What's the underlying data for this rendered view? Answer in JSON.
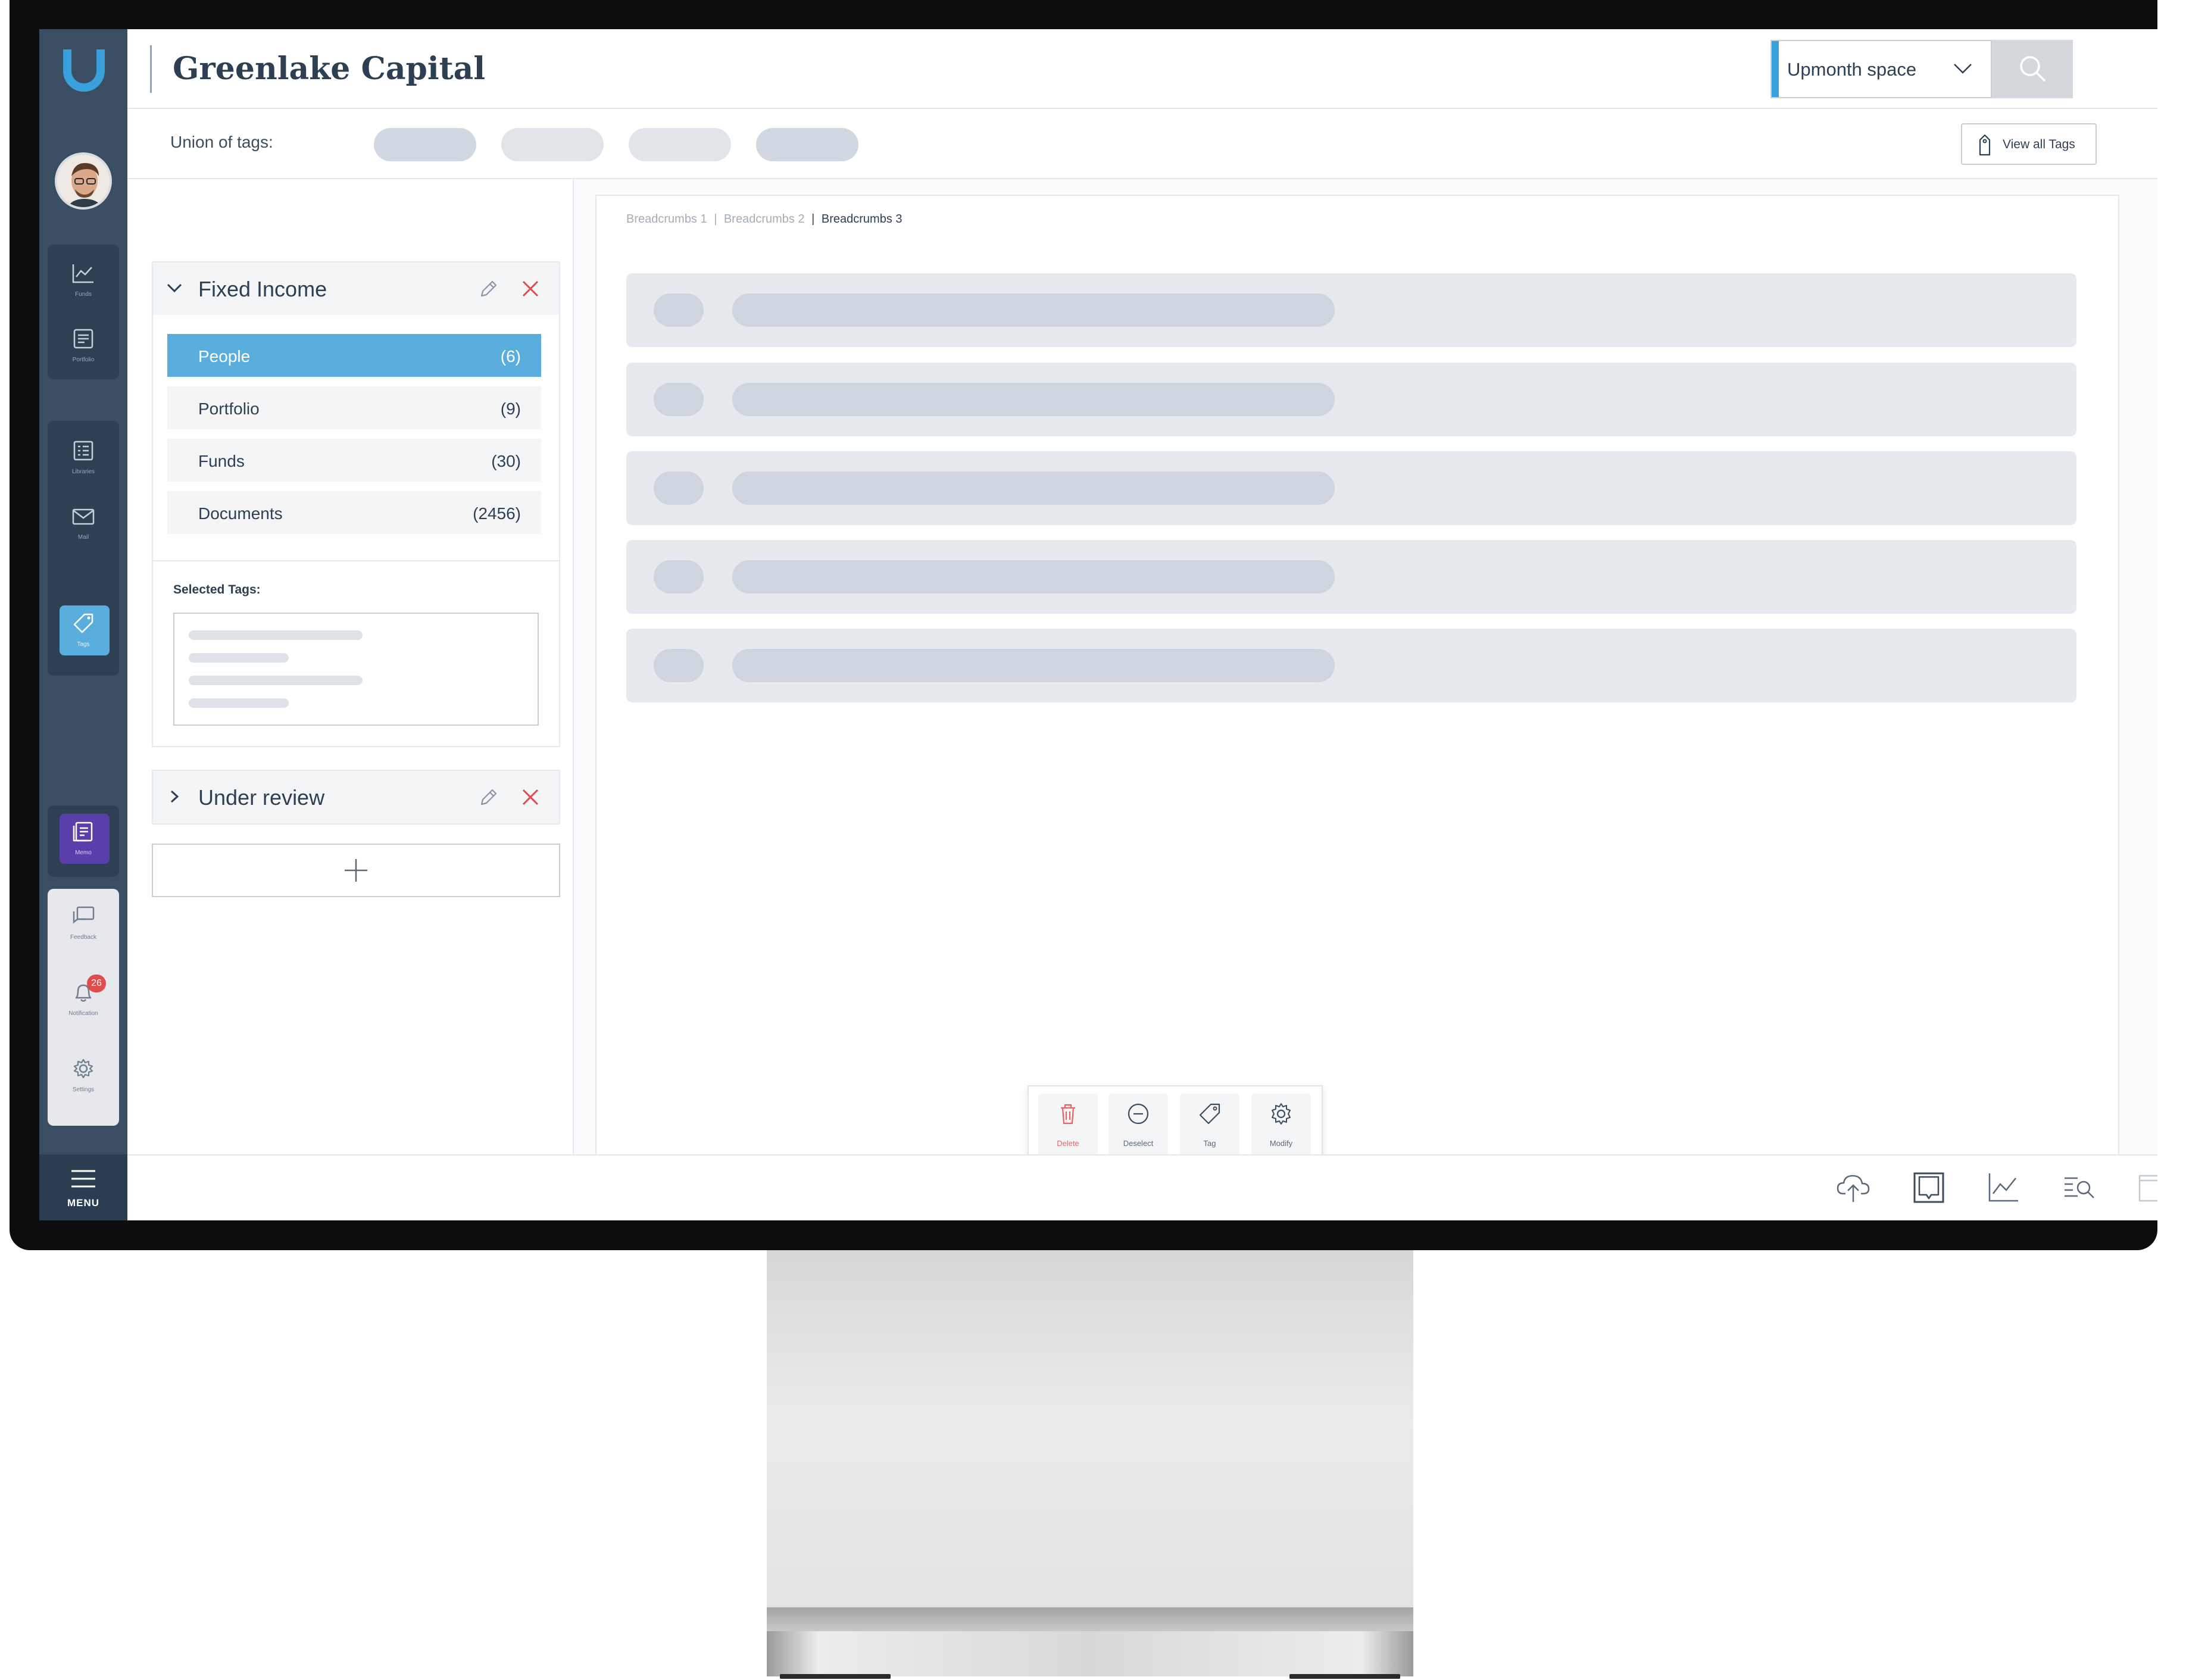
{
  "app": {
    "title": "Greenlake Capital"
  },
  "header": {
    "space_select": {
      "value": "Upmonth space"
    }
  },
  "tags_bar": {
    "label": "Union of tags:",
    "view_all_label": "View all Tags"
  },
  "sidebar": {
    "items": [
      {
        "label": "Funds",
        "icon": "chart-line-icon"
      },
      {
        "label": "Portfolio",
        "icon": "portfolio-icon"
      },
      {
        "label": "Libraries",
        "icon": "library-icon"
      },
      {
        "label": "Mail",
        "icon": "mail-icon"
      },
      {
        "label": "Tags",
        "icon": "tag-icon",
        "active": true
      },
      {
        "label": "Memo",
        "icon": "memo-icon"
      },
      {
        "label": "Feedback",
        "icon": "feedback-icon"
      },
      {
        "label": "Notification",
        "icon": "bell-icon",
        "badge": "26"
      },
      {
        "label": "Settings",
        "icon": "gear-icon"
      }
    ],
    "menu_label": "MENU"
  },
  "left_panel": {
    "groups": [
      {
        "title": "Fixed Income",
        "expanded": true,
        "categories": [
          {
            "name": "People",
            "count": "(6)",
            "active": true
          },
          {
            "name": "Portfolio",
            "count": "(9)"
          },
          {
            "name": "Funds",
            "count": "(30)"
          },
          {
            "name": "Documents",
            "count": "(2456)"
          }
        ],
        "selected_tags_label": "Selected Tags:"
      },
      {
        "title": "Under review",
        "expanded": false
      }
    ]
  },
  "main": {
    "breadcrumbs": [
      "Breadcrumbs 1",
      "Breadcrumbs 2",
      "Breadcrumbs 3"
    ],
    "action_bar": [
      {
        "label": "Delete",
        "icon": "trash-icon"
      },
      {
        "label": "Deselect",
        "icon": "minus-circle-icon"
      },
      {
        "label": "Tag",
        "icon": "tag-icon"
      },
      {
        "label": "Modify",
        "icon": "gear-icon"
      }
    ]
  },
  "bottom_bar": {
    "icons": [
      "cloud-upload-icon",
      "tablet-icon",
      "chart-line-icon",
      "search-list-icon",
      "layout-icon"
    ]
  },
  "colors": {
    "rail": "#3a4e63",
    "accent": "#5aaede",
    "memo": "#5a3eaa",
    "danger": "#e04c4c"
  }
}
